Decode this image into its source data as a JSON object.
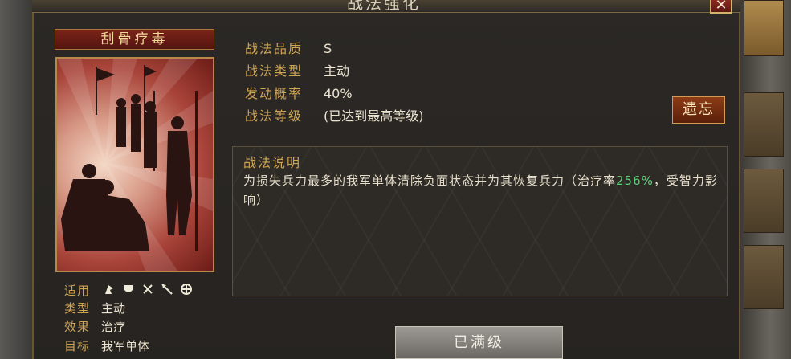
{
  "window": {
    "title": "战法强化",
    "close_icon": "✕"
  },
  "skill": {
    "name": "刮骨疗毒"
  },
  "attributes": {
    "applicable_label": "适用",
    "troop_icons": [
      "cavalry-icon",
      "shield-icon",
      "bow-icon",
      "spear-icon",
      "siege-icon"
    ],
    "type_label": "类型",
    "type_value": "主动",
    "effect_label": "效果",
    "effect_value": "治疗",
    "target_label": "目标",
    "target_value": "我军单体"
  },
  "info": {
    "quality_label": "战法品质",
    "quality_value": "S",
    "kind_label": "战法类型",
    "kind_value": "主动",
    "rate_label": "发动概率",
    "rate_value": "40%",
    "level_label": "战法等级",
    "level_value": "(已达到最高等级)"
  },
  "forget_button": "遗忘",
  "description": {
    "title": "战法说明",
    "text_part1": "为损失兵力最多的我军单体清除负面状态并为其恢复兵力（治疗率",
    "highlight": "256%",
    "text_part2": "，受智力影响）"
  },
  "maxed_button": "已满级"
}
